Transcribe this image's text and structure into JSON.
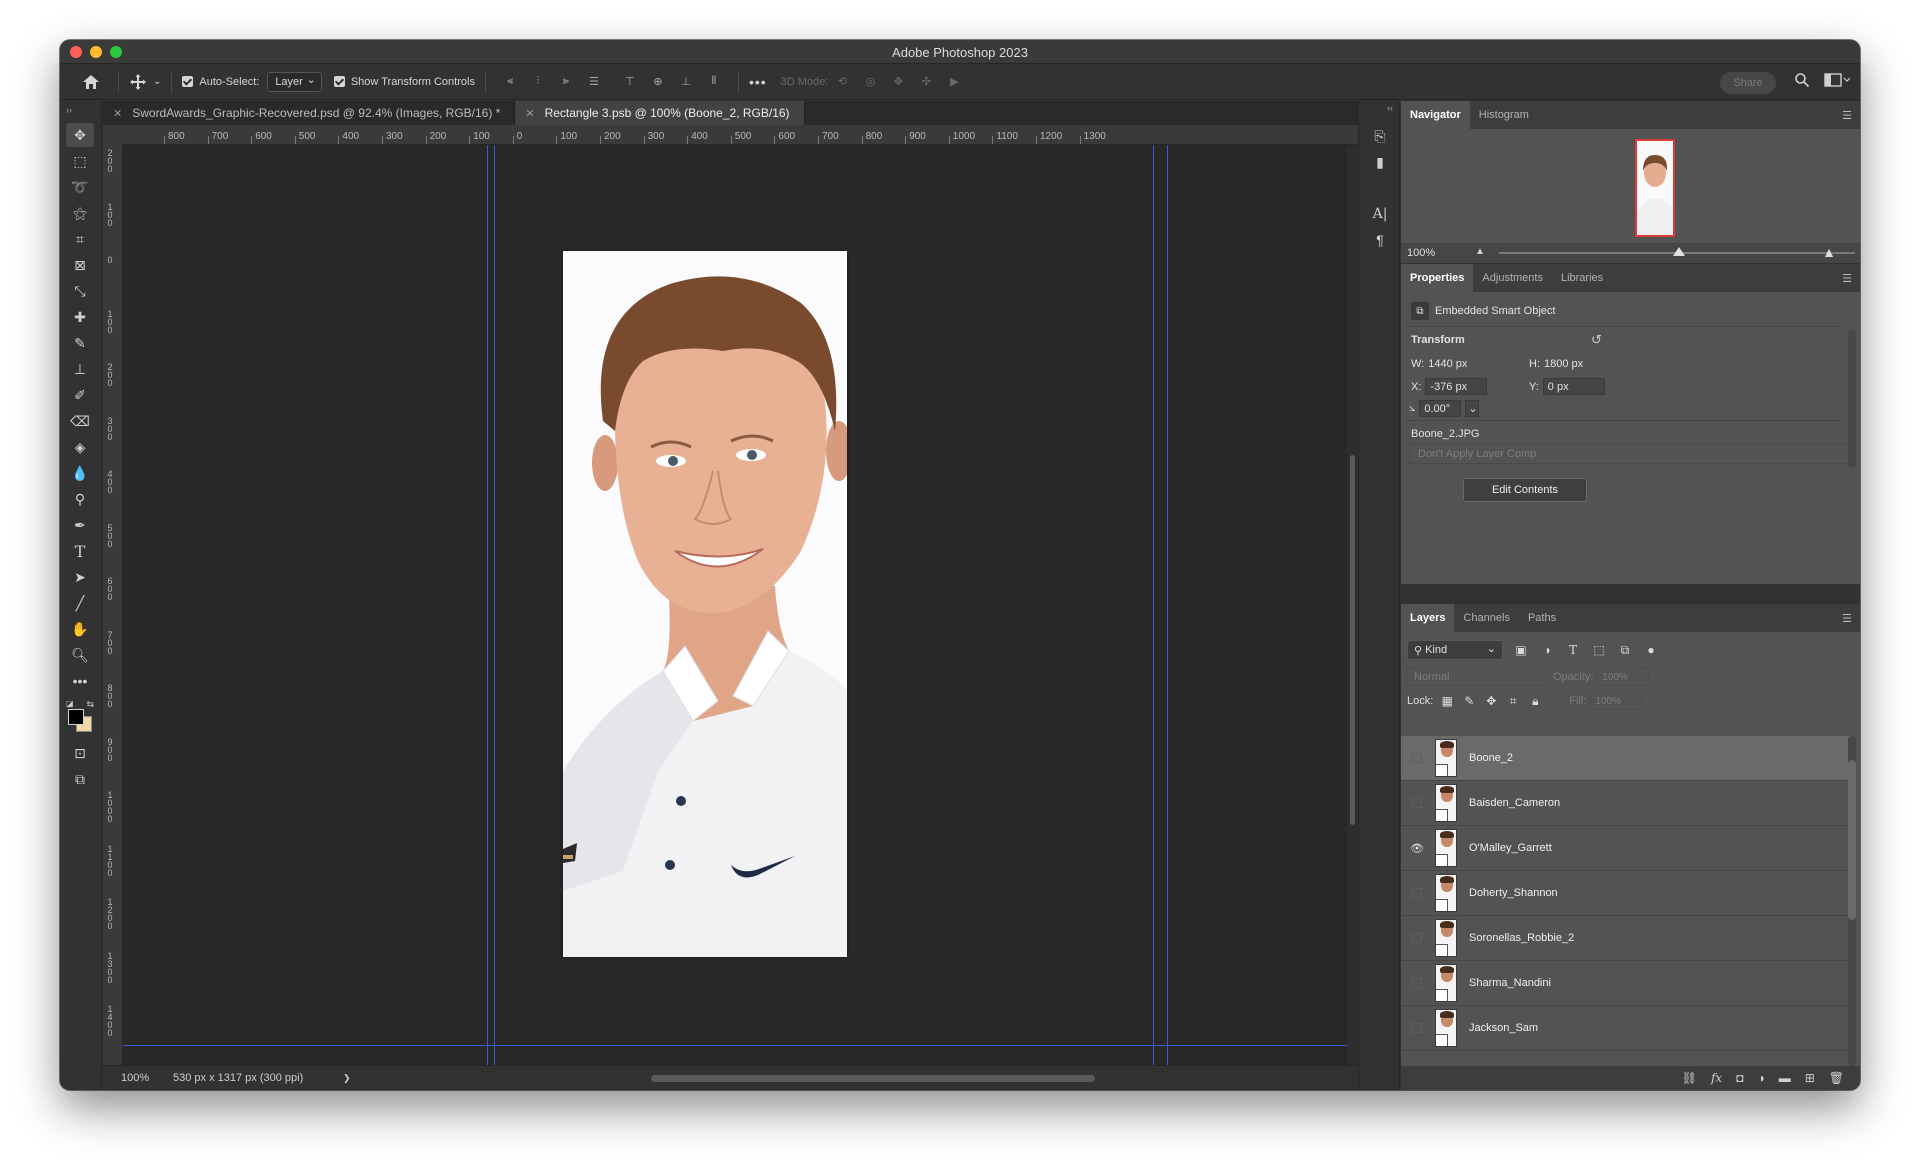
{
  "window": {
    "title": "Adobe Photoshop 2023"
  },
  "options_bar": {
    "auto_select_label": "Auto-Select:",
    "auto_select_value": "Layer",
    "show_transform_label": "Show Transform Controls",
    "mode_3d_label": "3D Mode:",
    "share_label": "Share"
  },
  "doc_tabs": [
    {
      "label": "SwordAwards_Graphic-Recovered.psd @ 92.4% (Images, RGB/16) *"
    },
    {
      "label": "Rectangle 3.psb @ 100% (Boone_2, RGB/16)"
    }
  ],
  "ruler_h": [
    "800",
    "700",
    "600",
    "500",
    "400",
    "300",
    "200",
    "100",
    "0",
    "100",
    "200",
    "300",
    "400",
    "500",
    "600",
    "700",
    "800",
    "900",
    "1000",
    "1100",
    "1200",
    "1300"
  ],
  "ruler_v": [
    "200",
    "100",
    "0",
    "100",
    "200",
    "300",
    "400",
    "500",
    "600",
    "700",
    "800",
    "900",
    "1000",
    "1100",
    "1200",
    "1300",
    "1400"
  ],
  "status": {
    "zoom": "100%",
    "doc_info": "530 px x 1317 px (300 ppi)",
    "more": "❯"
  },
  "navigator": {
    "tabs": [
      "Navigator",
      "Histogram"
    ],
    "zoom": "100%"
  },
  "properties": {
    "tabs": [
      "Properties",
      "Adjustments",
      "Libraries"
    ],
    "object_type": "Embedded Smart Object",
    "section_title": "Transform",
    "w_label": "W:",
    "w_value": "1440 px",
    "h_label": "H:",
    "h_value": "1800 px",
    "x_label": "X:",
    "x_value": "-376 px",
    "y_label": "Y:",
    "y_value": "0 px",
    "angle_value": "0.00°",
    "source_file": "Boone_2.JPG",
    "layer_comp": "Don't Apply Layer Comp",
    "edit_button": "Edit Contents"
  },
  "layers": {
    "tabs": [
      "Layers",
      "Channels",
      "Paths"
    ],
    "kind_label": "Kind",
    "blend_mode": "Normal",
    "opacity_label": "Opacity:",
    "opacity_value": "100%",
    "lock_label": "Lock:",
    "fill_label": "Fill:",
    "fill_value": "100%",
    "items": [
      {
        "name": "Boone_2",
        "visible": false,
        "selected": true
      },
      {
        "name": "Baisden_Cameron",
        "visible": false,
        "selected": false
      },
      {
        "name": "O'Malley_Garrett",
        "visible": true,
        "selected": false
      },
      {
        "name": "Doherty_Shannon",
        "visible": false,
        "selected": false
      },
      {
        "name": "Soronellas_Robbie_2",
        "visible": false,
        "selected": false
      },
      {
        "name": "Sharma_Nandini",
        "visible": false,
        "selected": false
      },
      {
        "name": "Jackson_Sam",
        "visible": false,
        "selected": false
      }
    ]
  }
}
